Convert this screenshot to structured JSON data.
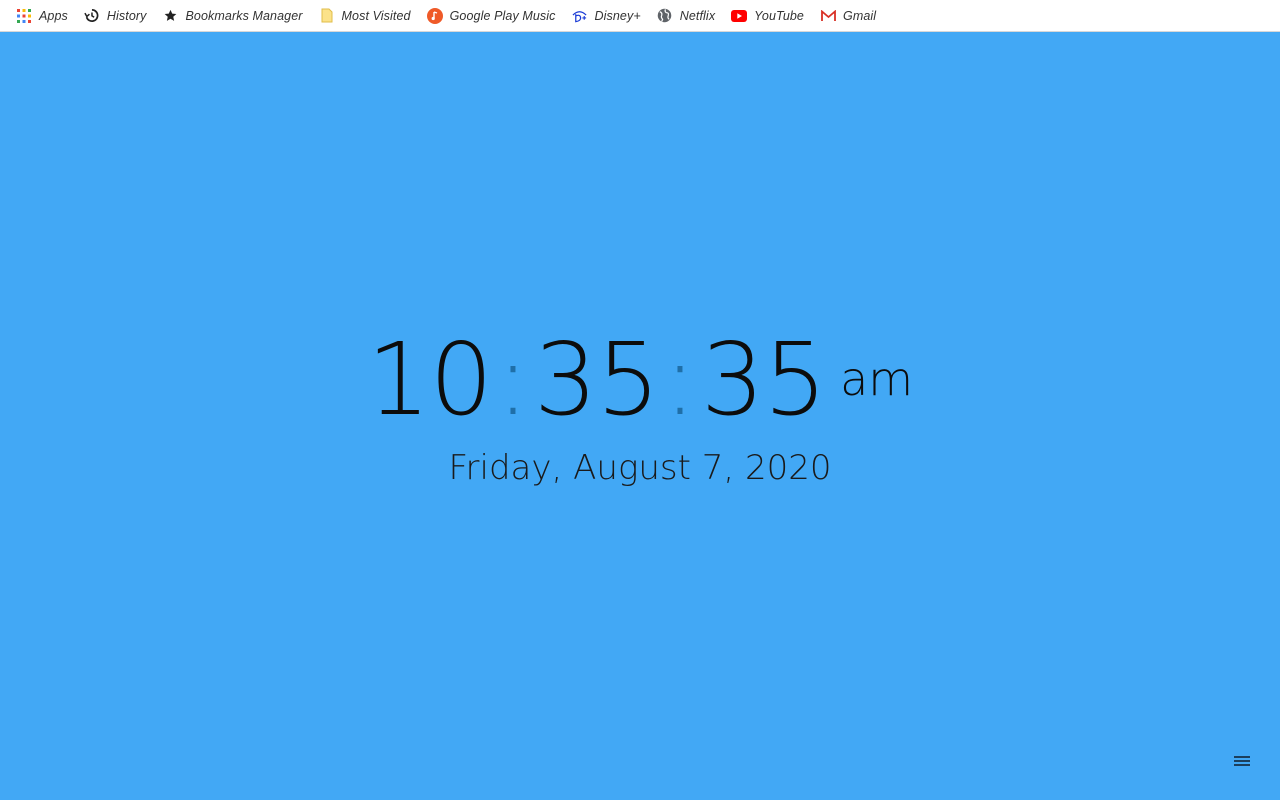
{
  "bookmarks_bar": {
    "items": [
      {
        "label": "Apps",
        "icon": "apps-grid-icon"
      },
      {
        "label": "History",
        "icon": "history-icon"
      },
      {
        "label": "Bookmarks Manager",
        "icon": "star-icon"
      },
      {
        "label": "Most Visited",
        "icon": "folder-icon"
      },
      {
        "label": "Google Play Music",
        "icon": "google-play-music-icon"
      },
      {
        "label": "Disney+",
        "icon": "disney-plus-icon"
      },
      {
        "label": "Netflix",
        "icon": "globe-icon"
      },
      {
        "label": "YouTube",
        "icon": "youtube-icon"
      },
      {
        "label": "Gmail",
        "icon": "gmail-icon"
      }
    ]
  },
  "clock": {
    "hours": "10",
    "minutes": "35",
    "seconds": "35",
    "separator": ":",
    "ampm": "am"
  },
  "date": "Friday, August 7, 2020",
  "menu": {
    "icon": "hamburger-menu-icon"
  },
  "colors": {
    "background": "#42a8f5",
    "separator": "#1f6fa8",
    "text": "#0c0c0c"
  }
}
